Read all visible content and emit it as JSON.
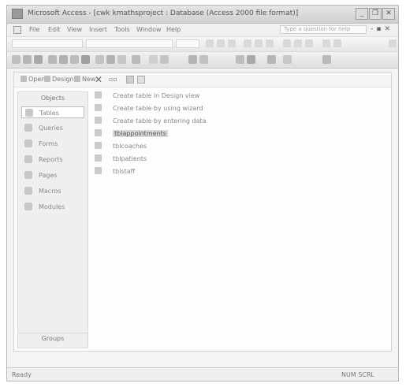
{
  "window": {
    "title": "Microsoft Access - [cwk kmathsproject : Database (Access 2000 file format)]"
  },
  "menu": {
    "items": [
      "File",
      "Edit",
      "View",
      "Insert",
      "Tools",
      "Window",
      "Help"
    ],
    "help_placeholder": "Type a question for help"
  },
  "db_toolbar": {
    "open": "Open",
    "design": "Design",
    "new": "New"
  },
  "objects": {
    "header": "Objects",
    "items": [
      "Tables",
      "Queries",
      "Forms",
      "Reports",
      "Pages",
      "Macros",
      "Modules"
    ],
    "selected": "Tables",
    "footer": "Groups"
  },
  "list": {
    "items": [
      "Create table in Design view",
      "Create table by using wizard",
      "Create table by entering data",
      "tblappointments",
      "tblcoaches",
      "tblpatients",
      "tblstaff"
    ],
    "highlighted": "tblappointments"
  },
  "status": {
    "left": "Ready",
    "right": "NUM SCRL"
  },
  "colors": {
    "window_bg": "#f4f4f4",
    "selection": "#d9d9d9"
  }
}
